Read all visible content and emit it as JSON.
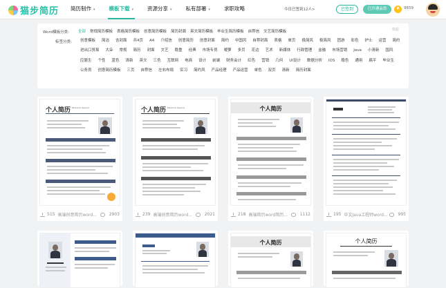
{
  "logo": {
    "text": "猫步简历"
  },
  "nav": [
    {
      "label": "简历制作",
      "caret": "▾"
    },
    {
      "label": "模板下载",
      "caret": "▾"
    },
    {
      "label": "资源分享",
      "caret": "▾"
    },
    {
      "label": "私有部署",
      "caret": "▾"
    },
    {
      "label": "求职攻略",
      "caret": ""
    }
  ],
  "header": {
    "signin_text": "今日已签到12人>",
    "sign_button": "已签到",
    "vip_button": "已开通会员",
    "coin_symbol": "¥",
    "coin_value": "9659"
  },
  "filter": {
    "row1_label": "Word模板分类:",
    "row1_tags": [
      "全部",
      "常规简历模板",
      "表格简历模板",
      "创意简历模板",
      "简历封面",
      "英文简历模板",
      "毕业生简历模板",
      "自荐信",
      "文艺简历模板"
    ],
    "row1_selected": "全部",
    "fold": "收起",
    "row2_label": "标签分类:",
    "row2_tags": [
      "创意模板",
      "简洁",
      "含封面",
      "共4页",
      "A4",
      "介绍信",
      "创意简历",
      "创意封面",
      "简约",
      "中国风",
      "自荐封面",
      "表格",
      "单页",
      "极简风",
      "极简风",
      "团游",
      "彩色",
      "护士",
      "运营",
      "简约",
      "进出口贸易",
      "大朵",
      "常规",
      "简历",
      "封面",
      "文艺",
      "稳重",
      "经典",
      "市场专员",
      "嗳萝",
      "多页",
      "花边",
      "艺术",
      "新媒体",
      "行政管理",
      "金融",
      "市场营销",
      "Java",
      "小清新",
      "国风",
      "应届生",
      "个性",
      "蓝色",
      "清新",
      "英文",
      "三色",
      "互联网",
      "电商",
      "设计",
      "前端",
      "财务会计",
      "红色",
      "营销",
      "几何",
      "UI设计",
      "数据分析",
      "IOS",
      "稳色",
      "通用",
      "扁平",
      "毕业生",
      "公务员",
      "创意简历模板",
      "三页",
      "自荐信",
      "左右布局",
      "实习",
      "简约风",
      "产品经理",
      "产品运营",
      "单色",
      "双页",
      "清新",
      "简历封面"
    ]
  },
  "cards": [
    {
      "downloads": "515",
      "title": "高端创意简历word...",
      "views": "2903",
      "heading": "个人简历",
      "sub": "Personal resume"
    },
    {
      "downloads": "239",
      "title": "高端创意简历word...",
      "views": "2021",
      "heading": "个人简历",
      "sub": "Personal resume"
    },
    {
      "downloads": "218",
      "title": "高端简历word简历...",
      "views": "1112",
      "heading": "个人简历",
      "sub": ""
    },
    {
      "downloads": "195",
      "title": "中文Java工程师word...",
      "views": "995",
      "heading": "",
      "sub": ""
    },
    {
      "downloads": "",
      "title": "",
      "views": "",
      "heading": "",
      "sub": ""
    },
    {
      "downloads": "",
      "title": "",
      "views": "",
      "heading": "",
      "sub": ""
    },
    {
      "downloads": "",
      "title": "",
      "views": "",
      "heading": "个人简历",
      "sub": ""
    },
    {
      "downloads": "",
      "title": "",
      "views": "",
      "heading": "个人简历",
      "sub": ""
    }
  ],
  "colors": {
    "accent": "#27b89f",
    "resume_dark": "#4a5a78"
  }
}
